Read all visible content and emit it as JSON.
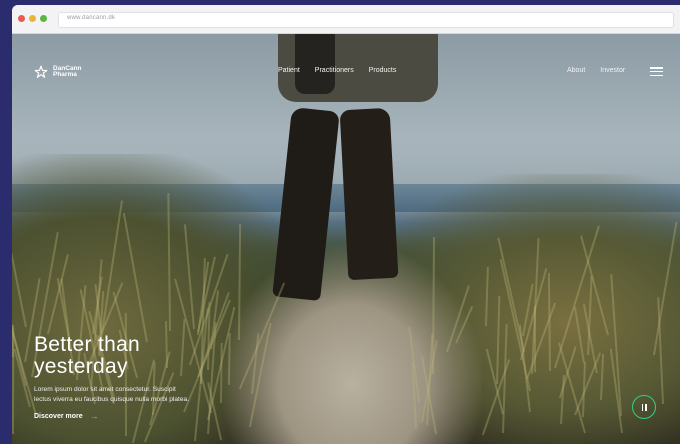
{
  "browser": {
    "url": "www.dancann.dk"
  },
  "brand": {
    "name_line1": "DanCann",
    "name_line2": "Pharma",
    "logo_icon": "star-logo-icon"
  },
  "nav": {
    "center_links": [
      {
        "label": "Patient"
      },
      {
        "label": "Practitioners"
      },
      {
        "label": "Products"
      }
    ],
    "right_links": [
      {
        "label": "About"
      },
      {
        "label": "Investor"
      }
    ],
    "menu_icon": "hamburger-menu-icon"
  },
  "hero": {
    "headline_line1": "Better than",
    "headline_line2": "yesterday",
    "body_line1": "Lorem ipsum dolor sit amet consectetur. Suscipit",
    "body_line2": "lectus viverra eu faucibus quisque nulla morbi platea.",
    "cta_label": "Discover more",
    "cta_arrow": "→",
    "pause_icon": "pause-icon"
  },
  "colors": {
    "page_bg": "#2b2c6e",
    "accent": "#2fd28a"
  }
}
